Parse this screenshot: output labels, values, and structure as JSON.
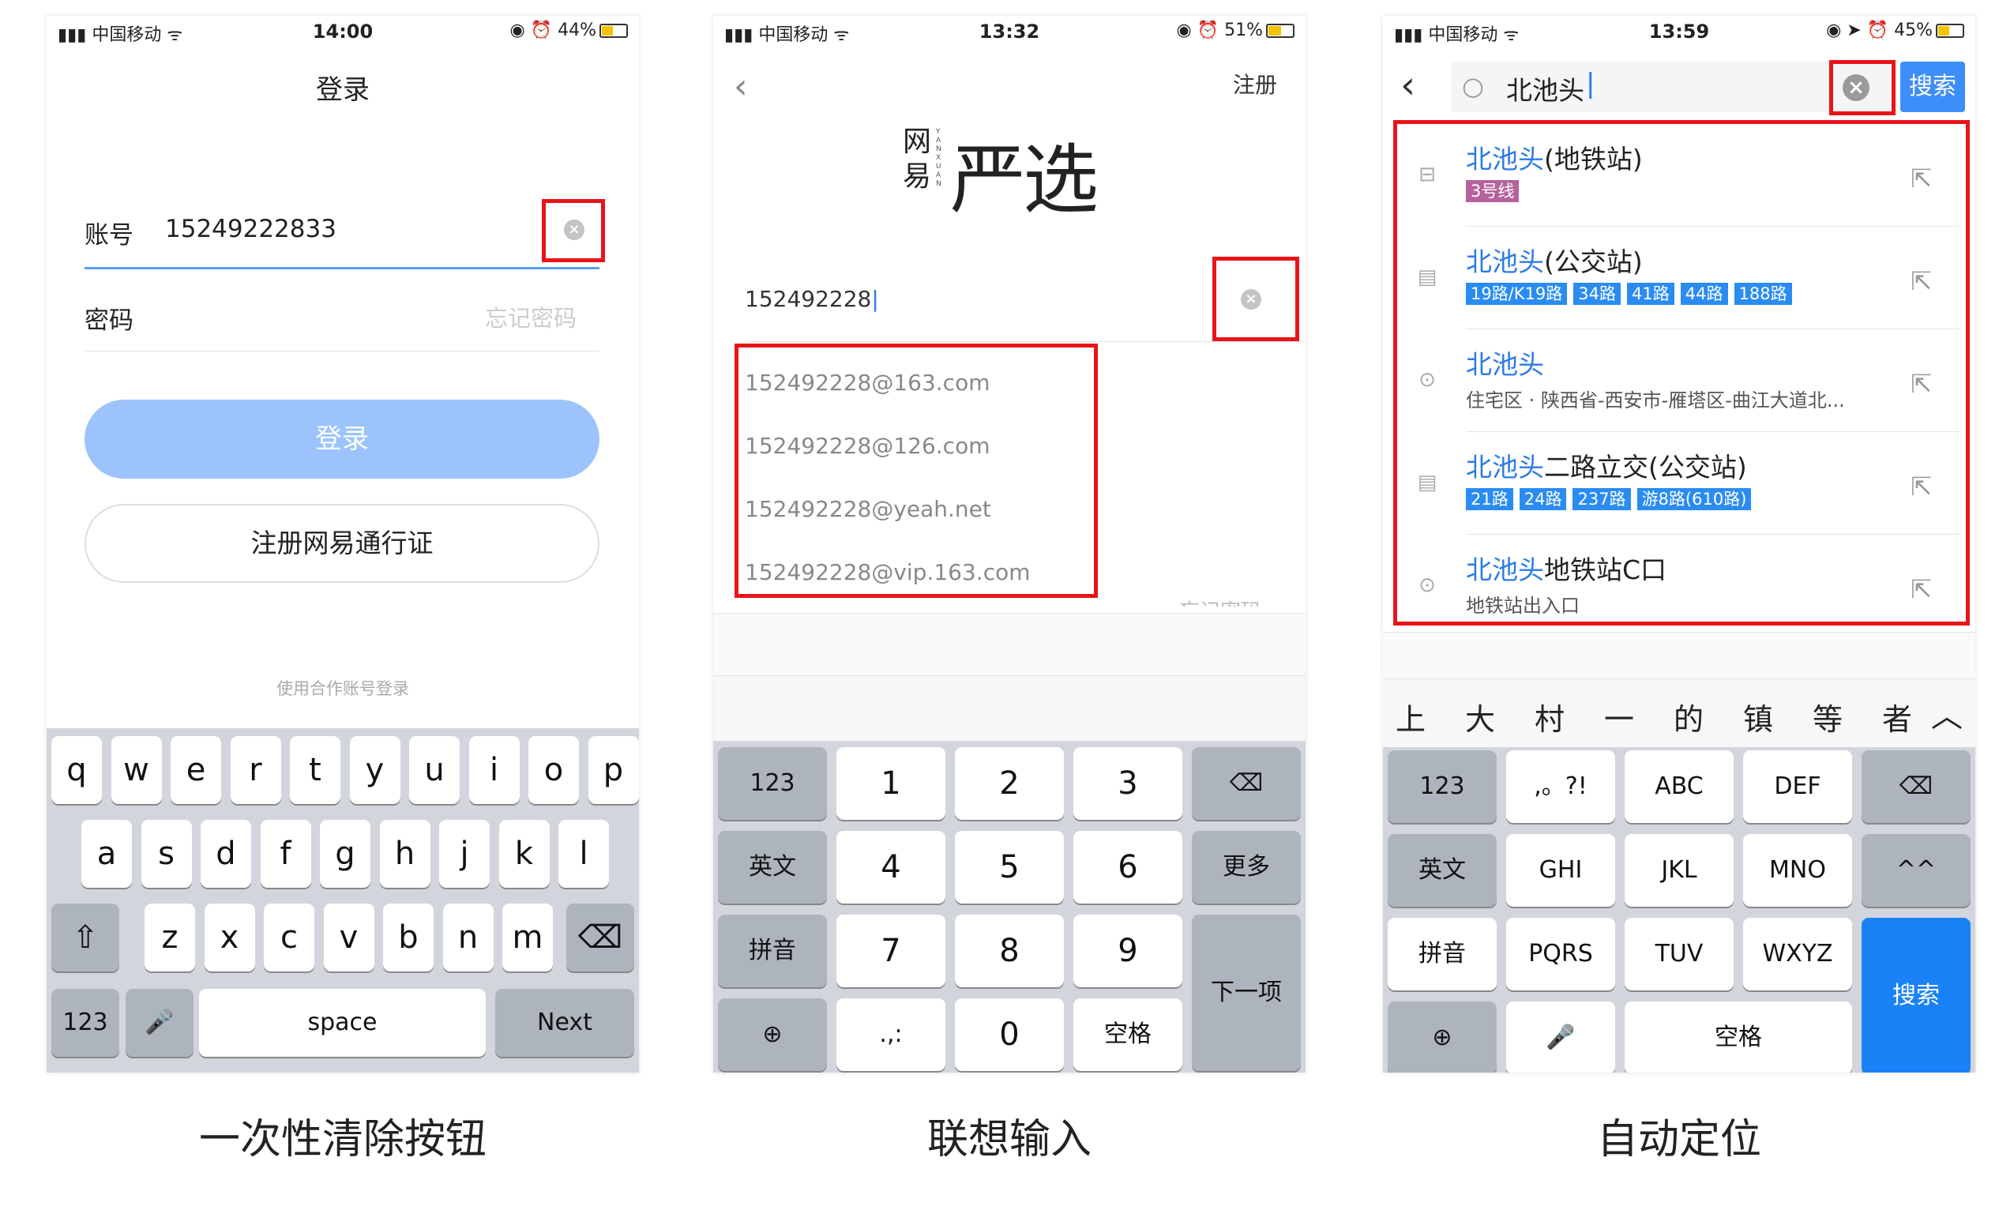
{
  "screens": [
    {
      "status": {
        "carrier": "▮▮▮ 中国移动 ᯤ",
        "time": "14:00",
        "battery": "44%"
      },
      "nav_title": "登录",
      "account_label": "账号",
      "account_value": "15249222833",
      "password_label": "密码",
      "forgot_password": "忘记密码",
      "login_button": "登录",
      "register_button": "注册网易通行证",
      "partner_login": "使用合作账号登录",
      "keyboard": {
        "row1": [
          "q",
          "w",
          "e",
          "r",
          "t",
          "y",
          "u",
          "i",
          "o",
          "p"
        ],
        "row2": [
          "a",
          "s",
          "d",
          "f",
          "g",
          "h",
          "j",
          "k",
          "l"
        ],
        "row3": [
          "z",
          "x",
          "c",
          "v",
          "b",
          "n",
          "m"
        ],
        "numbers": "123",
        "space": "space",
        "next": "Next"
      }
    },
    {
      "status": {
        "carrier": "▮▮▮ 中国移动 ᯤ",
        "time": "13:32",
        "battery": "51%"
      },
      "register_link": "注册",
      "logo_brand": "网易",
      "logo_main": "严选",
      "logo_pinyin": "YANXUAN",
      "input_value": "152492228",
      "suggestions": [
        "152492228@163.com",
        "152492228@126.com",
        "152492228@yeah.net",
        "152492228@vip.163.com"
      ],
      "forgot_password_peek": "忘记密码",
      "keyboard": {
        "col1": [
          "123",
          "英文",
          "拼音"
        ],
        "digits": [
          "1",
          "2",
          "3",
          "4",
          "5",
          "6",
          "7",
          "8",
          "9"
        ],
        "punct": ".,:",
        "zero": "0",
        "space": "空格",
        "more": "更多",
        "next": "下一项"
      }
    },
    {
      "status": {
        "carrier": "▮▮▮ 中国移动 ᯤ",
        "time": "13:59",
        "battery": "45%"
      },
      "search_value": "北池头",
      "search_button": "搜索",
      "results": [
        {
          "highlight": "北池头",
          "rest": "(地铁站)",
          "icon": "metro-icon",
          "tags": [
            {
              "text": "3号线",
              "color": "#b5629e"
            }
          ]
        },
        {
          "highlight": "北池头",
          "rest": "(公交站)",
          "icon": "bus-icon",
          "tags": [
            {
              "text": "19路/K19路",
              "color": "#2a8cf0"
            },
            {
              "text": "34路",
              "color": "#2a8cf0"
            },
            {
              "text": "41路",
              "color": "#2a8cf0"
            },
            {
              "text": "44路",
              "color": "#2a8cf0"
            },
            {
              "text": "188路",
              "color": "#2a8cf0"
            }
          ]
        },
        {
          "highlight": "北池头",
          "rest": "",
          "icon": "location-pin-icon",
          "sub": "住宅区 · 陕西省-西安市-雁塔区-曲江大道北..."
        },
        {
          "highlight": "北池头",
          "rest": "二路立交(公交站)",
          "icon": "bus-icon",
          "tags": [
            {
              "text": "21路",
              "color": "#2a8cf0"
            },
            {
              "text": "24路",
              "color": "#2a8cf0"
            },
            {
              "text": "237路",
              "color": "#2a8cf0"
            },
            {
              "text": "游8路(610路)",
              "color": "#2a8cf0"
            }
          ]
        },
        {
          "highlight": "北池头",
          "rest": "地铁站C口",
          "icon": "location-pin-icon",
          "sub": "地铁站出入口"
        }
      ],
      "candidates": [
        "上",
        "大",
        "村",
        "一",
        "的",
        "镇",
        "等",
        "者"
      ],
      "keyboard": {
        "col1": [
          "123",
          "英文",
          "拼音"
        ],
        "letters": [
          ",。?!",
          "ABC",
          "DEF",
          "GHI",
          "JKL",
          "MNO",
          "PQRS",
          "TUV",
          "WXYZ"
        ],
        "caret": "^^",
        "space": "空格",
        "search": "搜索"
      }
    }
  ],
  "captions": [
    "一次性清除按钮",
    "联想输入",
    "自动定位"
  ],
  "colors": {
    "highlight_red": "#e8141a",
    "login_blue": "#9cc3fb",
    "search_blue": "#1a82f7"
  }
}
